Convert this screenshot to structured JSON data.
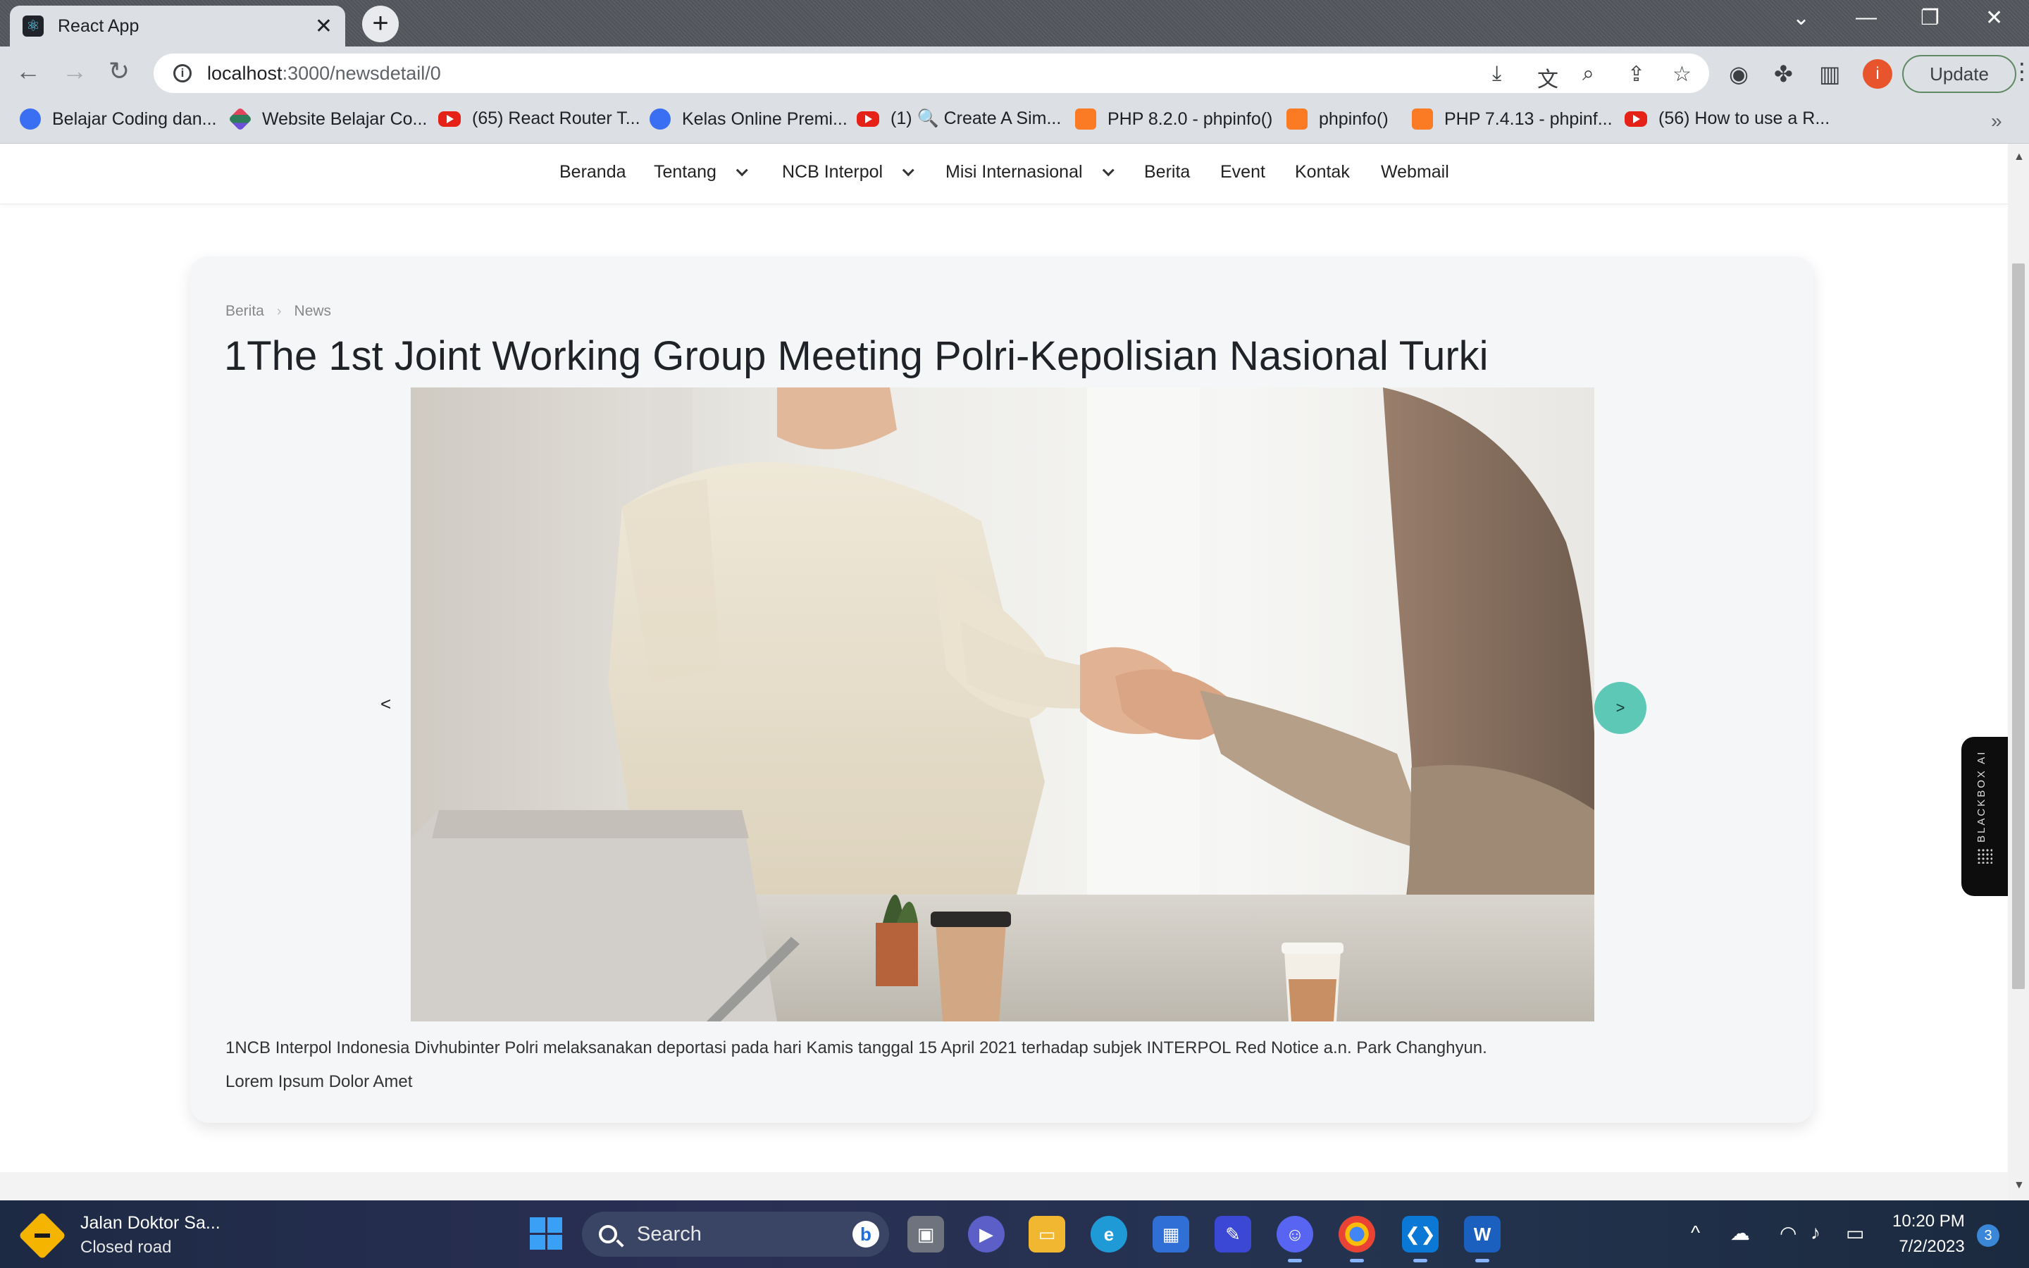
{
  "browser": {
    "tab_title": "React App",
    "url_host": "localhost",
    "url_path": ":3000/newsdetail/0",
    "update_label": "Update",
    "profile_initial": "i",
    "bookmarks": [
      {
        "label": "Belajar Coding dan...",
        "icon": "blue"
      },
      {
        "label": "Website Belajar Co...",
        "icon": "multi"
      },
      {
        "label": "(65) React Router T...",
        "icon": "yt"
      },
      {
        "label": "Kelas Online Premi...",
        "icon": "blue"
      },
      {
        "label": "(1) 🔍 Create A Sim...",
        "icon": "yt"
      },
      {
        "label": "PHP 8.2.0 - phpinfo()",
        "icon": "xampp"
      },
      {
        "label": "phpinfo()",
        "icon": "xampp"
      },
      {
        "label": "PHP 7.4.13 - phpinf...",
        "icon": "xampp"
      },
      {
        "label": "(56) How to use a R...",
        "icon": "yt"
      }
    ]
  },
  "site_nav": {
    "items": [
      {
        "label": "Beranda",
        "dropdown": false
      },
      {
        "label": "Tentang",
        "dropdown": true
      },
      {
        "label": "NCB Interpol",
        "dropdown": true
      },
      {
        "label": "Misi Internasional",
        "dropdown": true
      },
      {
        "label": "Berita",
        "dropdown": false
      },
      {
        "label": "Event",
        "dropdown": false
      },
      {
        "label": "Kontak",
        "dropdown": false
      },
      {
        "label": "Webmail",
        "dropdown": false
      }
    ]
  },
  "article": {
    "breadcrumb": [
      "Berita",
      "News"
    ],
    "title": "1The 1st Joint Working Group Meeting Polri-Kepolisian Nasional Turki",
    "carousel_prev": "<",
    "carousel_next": ">",
    "description": "1NCB Interpol Indonesia Divhubinter Polri melaksanakan deportasi pada hari Kamis tanggal 15 April 2021 terhadap subjek INTERPOL Red Notice a.n. Park Changhyun.",
    "body": "Lorem Ipsum Dolor Amet"
  },
  "extension": {
    "label": "BLACKBOX AI"
  },
  "taskbar": {
    "weather_title": "Jalan Doktor Sa...",
    "weather_status": "Closed road",
    "search_label": "Search",
    "time": "10:20 PM",
    "date": "7/2/2023",
    "notification_count": "3"
  },
  "colors": {
    "accent_teal": "#5ec8b6",
    "card_bg": "#f5f6f8",
    "chrome_bg": "#dcdfe3"
  }
}
